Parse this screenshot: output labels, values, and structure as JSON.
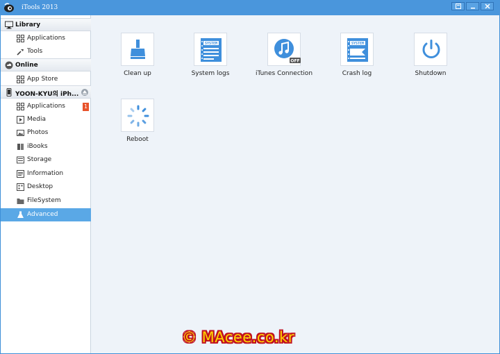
{
  "window": {
    "title": "iTools 2013"
  },
  "sidebar": {
    "library": {
      "label": "Library",
      "items": [
        {
          "label": "Applications",
          "icon": "apps-grid-icon"
        },
        {
          "label": "Tools",
          "icon": "wrench-icon"
        }
      ]
    },
    "online": {
      "label": "Online",
      "items": [
        {
          "label": "App Store",
          "icon": "apps-grid-icon"
        }
      ]
    },
    "device": {
      "label": "YOON-KYU의 iPh...",
      "items": [
        {
          "label": "Applications",
          "icon": "apps-grid-icon",
          "badge": "1"
        },
        {
          "label": "Media",
          "icon": "media-icon"
        },
        {
          "label": "Photos",
          "icon": "photos-icon"
        },
        {
          "label": "iBooks",
          "icon": "book-icon"
        },
        {
          "label": "Storage",
          "icon": "storage-icon"
        },
        {
          "label": "Information",
          "icon": "info-icon"
        },
        {
          "label": "Desktop",
          "icon": "desktop-icon"
        },
        {
          "label": "FileSystem",
          "icon": "folder-icon"
        },
        {
          "label": "Advanced",
          "icon": "flask-icon",
          "active": true
        }
      ]
    }
  },
  "tools": [
    {
      "label": "Clean up",
      "icon": "broom-icon"
    },
    {
      "label": "System logs",
      "icon": "system-log-icon",
      "icon_text": "SYSTEM"
    },
    {
      "label": "iTunes Connection",
      "icon": "itunes-icon",
      "status": "OFF"
    },
    {
      "label": "Crash log",
      "icon": "crash-log-icon",
      "icon_text": "SYSTEM"
    },
    {
      "label": "Shutdown",
      "icon": "power-icon"
    },
    {
      "label": "Reboot",
      "icon": "spinner-icon"
    }
  ],
  "watermark": "© MAcee.co.kr",
  "colors": {
    "accent": "#4a96dc",
    "active_item": "#5aa8e6",
    "icon_blue": "#3f8fdc",
    "badge": "#e8532b"
  }
}
